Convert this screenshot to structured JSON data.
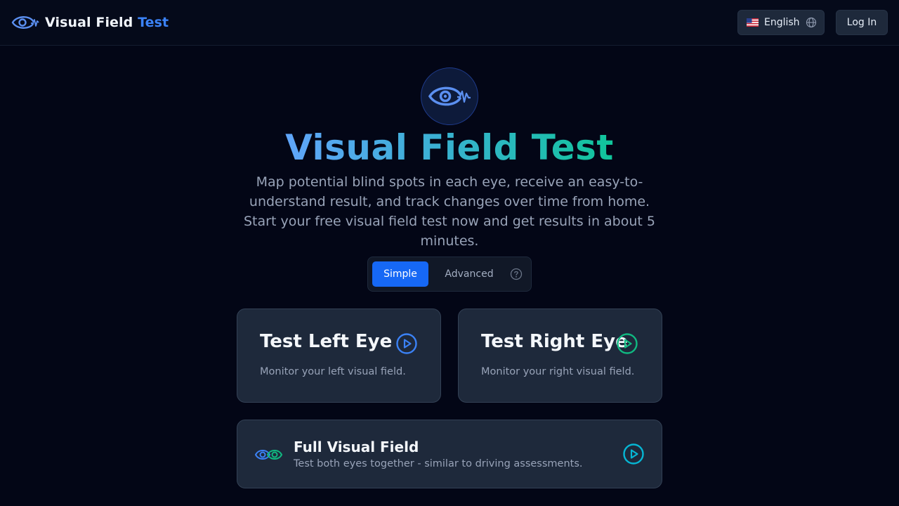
{
  "header": {
    "brand_part1": "Visual Field",
    "brand_part2": "Test",
    "brand_icon": "eye-pulse-icon",
    "language_flag": "us-flag-icon",
    "language_label": "English",
    "language_icon": "globe-icon",
    "login_label": "Log In"
  },
  "hero": {
    "icon": "eye-pulse-icon",
    "title": "Visual Field Test",
    "description": "Map potential blind spots in each eye, receive an easy-to-understand result, and track changes over time from home. Start your free visual field test now and get results in about 5 minutes."
  },
  "mode_toggle": {
    "simple_label": "Simple",
    "advanced_label": "Advanced",
    "selected": "Simple",
    "help_icon": "question-circle-icon"
  },
  "tests": {
    "left": {
      "title": "Test Left Eye",
      "description": "Monitor your left visual field.",
      "play_icon": "play-circle-icon"
    },
    "right": {
      "title": "Test Right Eye",
      "description": "Monitor your right visual field.",
      "play_icon": "play-circle-icon"
    },
    "full": {
      "title": "Full Visual Field",
      "description": "Test both eyes together - similar to driving assessments.",
      "icon": "two-eyes-icon",
      "play_icon": "play-circle-icon"
    }
  },
  "colors": {
    "background": "#030616",
    "primary": "#1668f5",
    "blue_accent": "#3b82f6",
    "green_accent": "#10b981",
    "cyan_accent": "#06b6d4",
    "card": "#1e293b"
  }
}
